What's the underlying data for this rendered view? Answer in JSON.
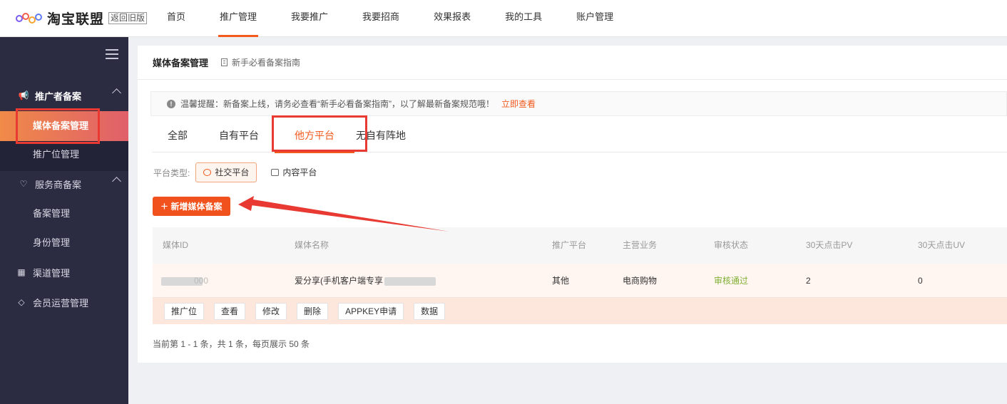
{
  "brand": {
    "name": "淘宝联盟",
    "old_version": "返回旧版"
  },
  "nav": [
    "首页",
    "推广管理",
    "我要推广",
    "我要招商",
    "效果报表",
    "我的工具",
    "账户管理"
  ],
  "sidebar": {
    "group_promoter": "推广者备案",
    "item_media": "媒体备案管理",
    "item_position": "推广位管理",
    "group_service": "服务商备案",
    "item_record": "备案管理",
    "item_identity": "身份管理",
    "item_channel": "渠道管理",
    "item_member": "会员运营管理"
  },
  "panel": {
    "title": "媒体备案管理",
    "guide": "新手必看备案指南",
    "notice": "温馨提醒：新备案上线，请务必查看“新手必看备案指南”，以了解最新备案规范哦！",
    "notice_link": "立即查看",
    "tabs": [
      "全部",
      "自有平台",
      "他方平台",
      "无自有阵地"
    ],
    "platform_type_label": "平台类型:",
    "chip_social": "社交平台",
    "chip_content": "内容平台",
    "add_button": "新增媒体备案",
    "columns": [
      "媒体ID",
      "媒体名称",
      "推广平台",
      "主营业务",
      "审核状态",
      "30天点击PV",
      "30天点击UV"
    ],
    "row": {
      "id_suffix": "000",
      "name": "爱分享(手机客户端专享",
      "platform": "其他",
      "business": "电商购物",
      "status": "审核通过",
      "pv": "2",
      "uv": "0"
    },
    "actions": [
      "推广位",
      "查看",
      "修改",
      "删除",
      "APPKEY申请",
      "数据"
    ],
    "pager": "当前第 1 - 1 条，共 1 条，每页展示 50 条"
  },
  "colors": {
    "accent": "#f25a1e",
    "annotation": "#e83a32",
    "sidebar_bg": "#2b2b42",
    "status_pass": "#7fb033"
  }
}
